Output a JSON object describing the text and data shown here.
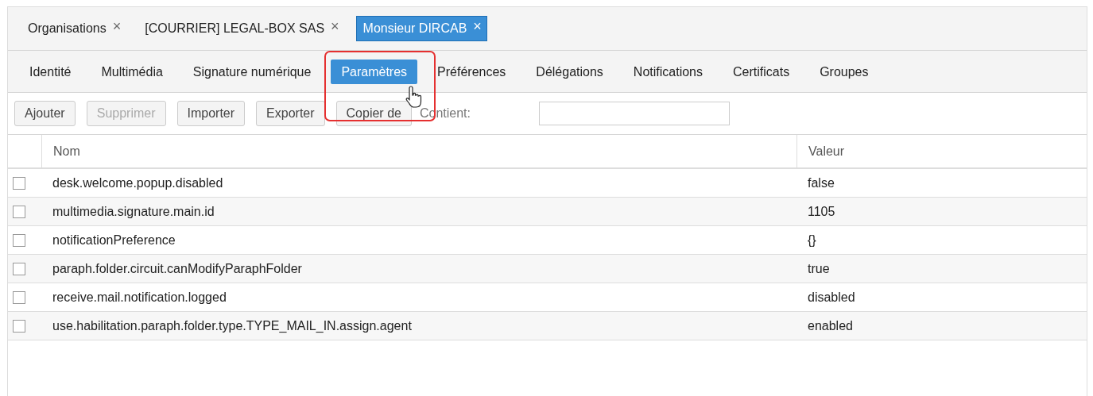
{
  "tabs": [
    {
      "label": "Organisations",
      "selected": false,
      "close": "×"
    },
    {
      "label": "[COURRIER] LEGAL-BOX SAS",
      "selected": false,
      "close": "×"
    },
    {
      "label": "Monsieur DIRCAB",
      "selected": true,
      "close": "×"
    }
  ],
  "subtabs": [
    {
      "label": "Identité",
      "selected": false
    },
    {
      "label": "Multimédia",
      "selected": false
    },
    {
      "label": "Signature numérique",
      "selected": false
    },
    {
      "label": "Paramètres",
      "selected": true
    },
    {
      "label": "Préférences",
      "selected": false
    },
    {
      "label": "Délégations",
      "selected": false
    },
    {
      "label": "Notifications",
      "selected": false
    },
    {
      "label": "Certificats",
      "selected": false
    },
    {
      "label": "Groupes",
      "selected": false
    }
  ],
  "toolbar": {
    "buttons": [
      {
        "label": "Ajouter",
        "disabled": false
      },
      {
        "label": "Supprimer",
        "disabled": true
      },
      {
        "label": "Importer",
        "disabled": false
      },
      {
        "label": "Exporter",
        "disabled": false
      },
      {
        "label": "Copier de",
        "disabled": false
      }
    ],
    "filter_label": "Contient:"
  },
  "table": {
    "columns": [
      "Nom",
      "Valeur"
    ],
    "rows": [
      {
        "name": "desk.welcome.popup.disabled",
        "value": "false",
        "checked": false
      },
      {
        "name": "multimedia.signature.main.id",
        "value": "1105",
        "checked": false
      },
      {
        "name": "notificationPreference",
        "value": "{}",
        "checked": false
      },
      {
        "name": "paraph.folder.circuit.canModifyParaphFolder",
        "value": "true",
        "checked": false
      },
      {
        "name": "receive.mail.notification.logged",
        "value": "disabled",
        "checked": false
      },
      {
        "name": "use.habilitation.paraph.folder.type.TYPE_MAIL_IN.assign.agent",
        "value": "enabled",
        "checked": false
      }
    ]
  }
}
